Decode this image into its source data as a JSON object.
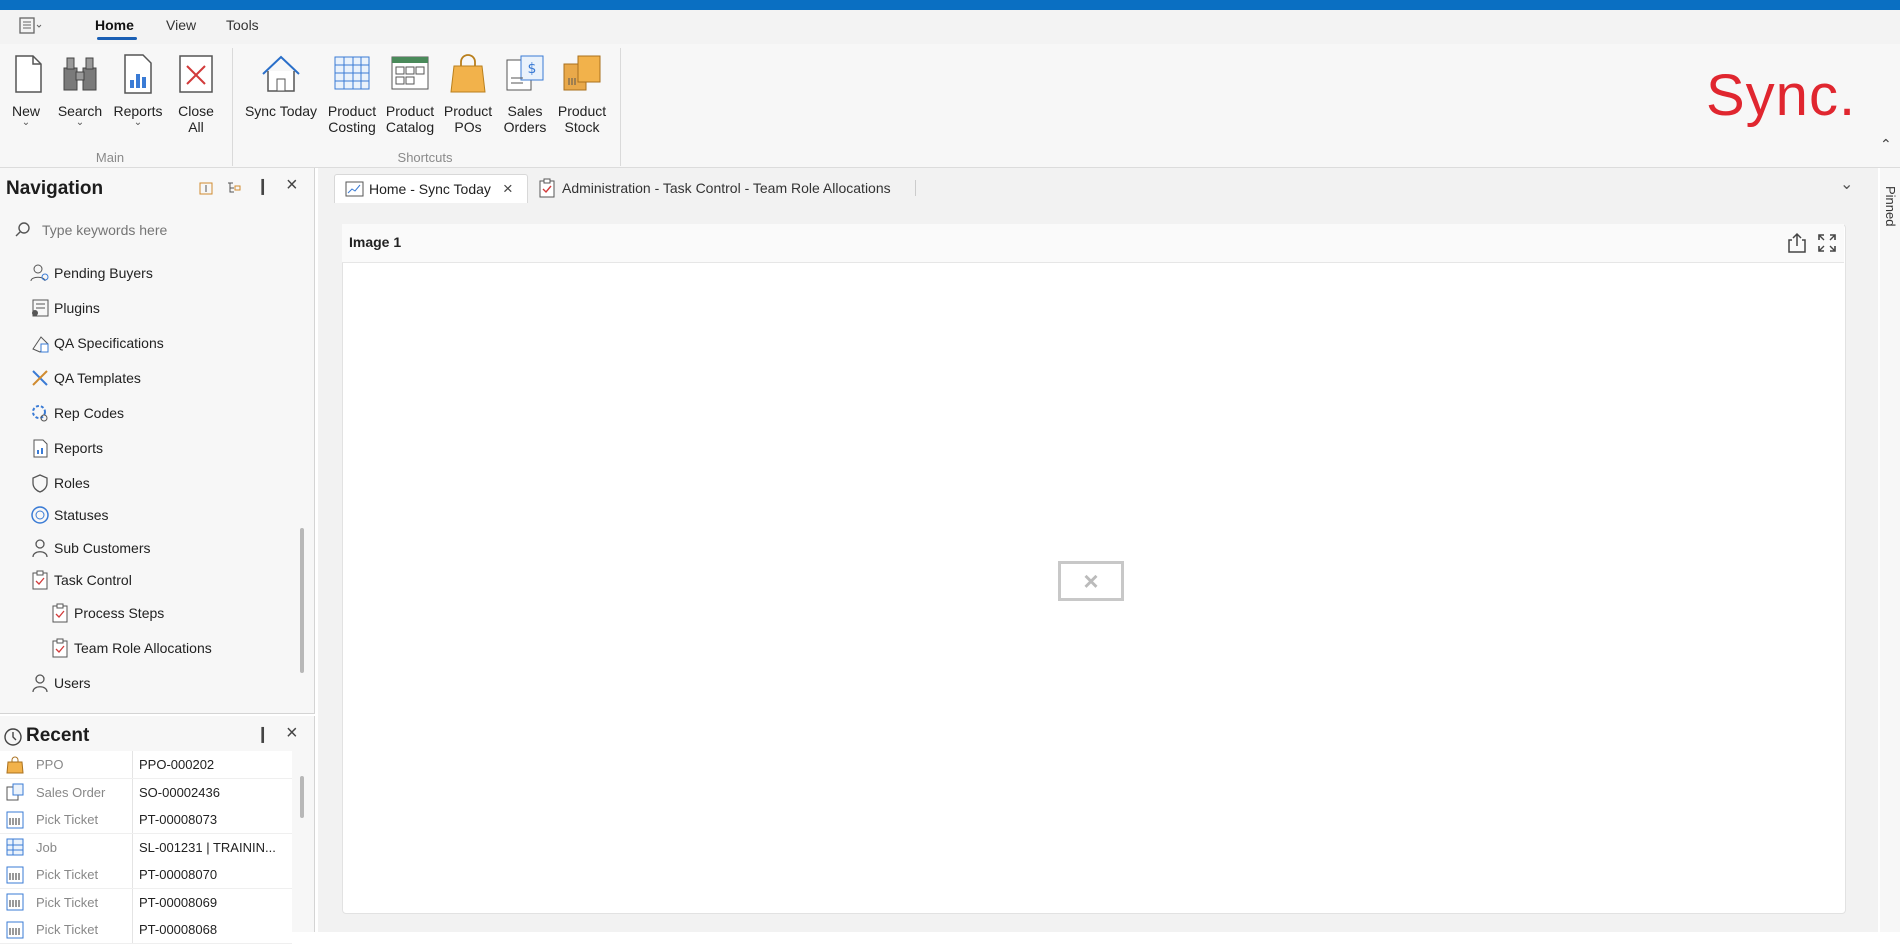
{
  "ribbon_tabs": [
    "Home",
    "View",
    "Tools"
  ],
  "ribbon": {
    "main": {
      "new": "New",
      "search": "Search",
      "reports": "Reports",
      "close_all": "Close\nAll",
      "group_label": "Main"
    },
    "shortcuts": {
      "sync_today": "Sync Today",
      "product_costing": "Product\nCosting",
      "product_catalog": "Product\nCatalog",
      "product_pos": "Product\nPOs",
      "sales_orders": "Sales\nOrders",
      "product_stock": "Product\nStock",
      "group_label": "Shortcuts"
    },
    "brand": "Sync.",
    "brand_color": "#e0262f"
  },
  "navigation": {
    "title": "Navigation",
    "search_placeholder": "Type keywords here",
    "items": [
      {
        "label": "Pending Buyers",
        "icon": "users-icon"
      },
      {
        "label": "Plugins",
        "icon": "plugin-icon"
      },
      {
        "label": "QA Specifications",
        "icon": "qa-spec-icon"
      },
      {
        "label": "QA Templates",
        "icon": "tools-icon"
      },
      {
        "label": "Rep Codes",
        "icon": "gear-user-icon"
      },
      {
        "label": "Reports",
        "icon": "report-icon"
      },
      {
        "label": "Roles",
        "icon": "shield-icon"
      },
      {
        "label": "Statuses",
        "icon": "status-icon"
      },
      {
        "label": "Sub Customers",
        "icon": "user-icon"
      },
      {
        "label": "Task Control",
        "icon": "clipboard-icon"
      },
      {
        "label": "Process Steps",
        "icon": "clipboard-icon"
      },
      {
        "label": "Team Role Allocations",
        "icon": "clipboard-icon"
      },
      {
        "label": "Users",
        "icon": "user-icon"
      }
    ]
  },
  "recent": {
    "title": "Recent",
    "rows": [
      {
        "type": "PPO",
        "value": "PPO-000202",
        "icon": "bag-icon"
      },
      {
        "type": "Sales Order",
        "value": "SO-00002436",
        "icon": "sales-order-icon"
      },
      {
        "type": "Pick Ticket",
        "value": "PT-00008073",
        "icon": "pick-ticket-icon"
      },
      {
        "type": "Job",
        "value": "SL-001231 | TRAININ...",
        "icon": "grid-icon"
      },
      {
        "type": "Pick Ticket",
        "value": "PT-00008070",
        "icon": "pick-ticket-icon"
      },
      {
        "type": "Pick Ticket",
        "value": "PT-00008069",
        "icon": "pick-ticket-icon"
      },
      {
        "type": "Pick Ticket",
        "value": "PT-00008068",
        "icon": "pick-ticket-icon"
      }
    ]
  },
  "document_tabs": [
    {
      "label": "Home - Sync Today",
      "active": true
    },
    {
      "label": "Administration - Task Control - Team Role Allocations",
      "active": false
    }
  ],
  "card": {
    "title": "Image 1"
  },
  "side_pin_label": "Pinned"
}
